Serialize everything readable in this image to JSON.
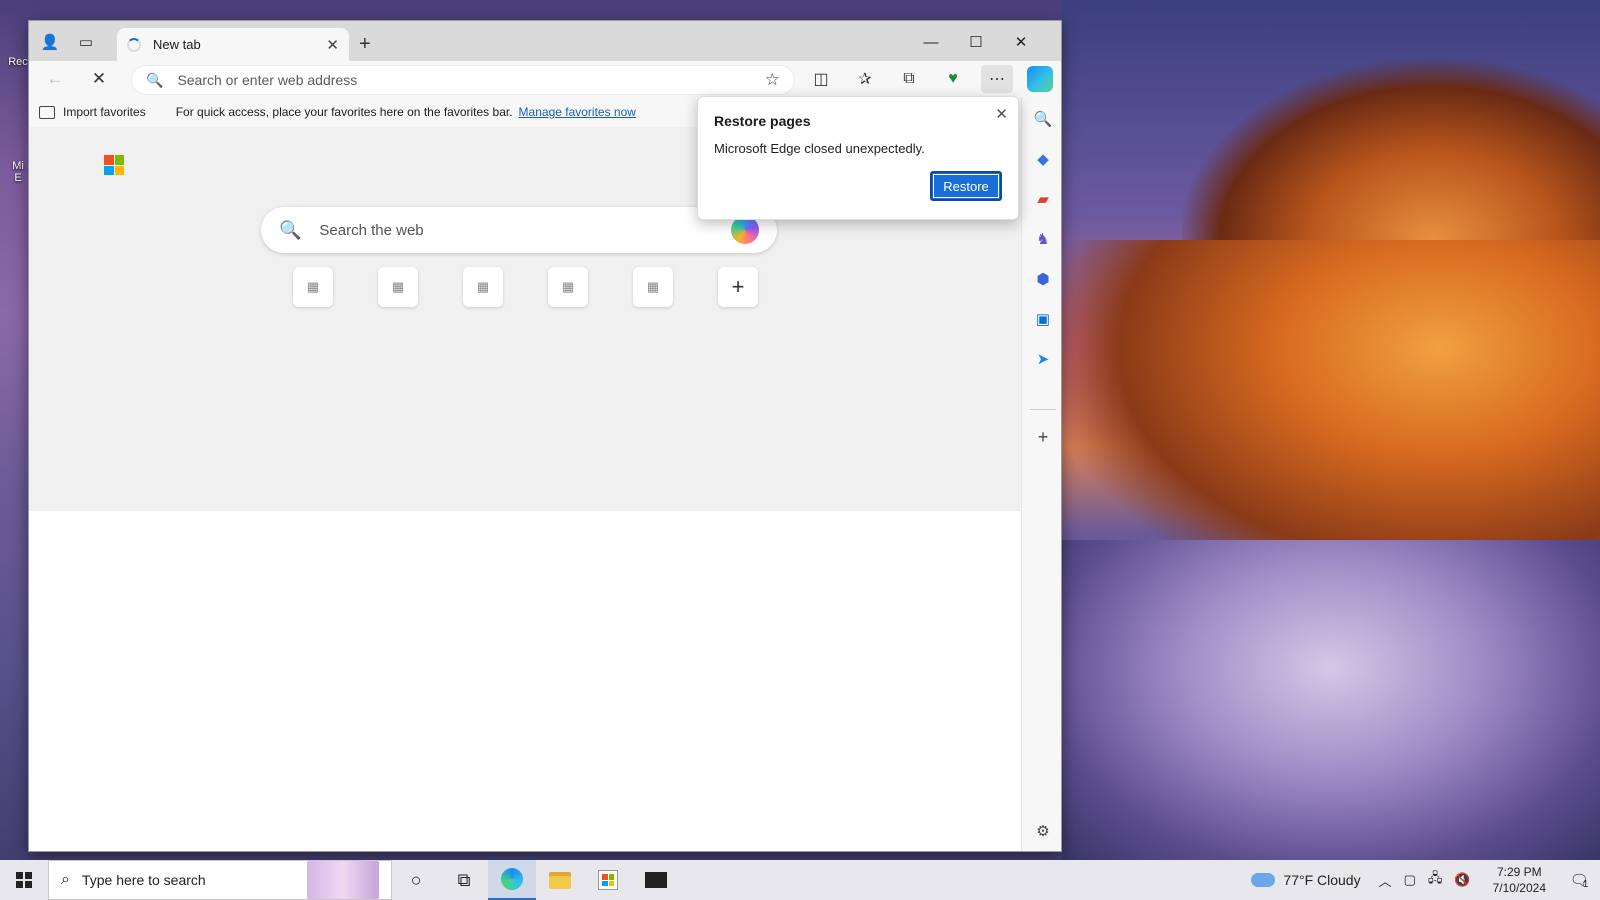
{
  "desktop": {
    "icons": [
      {
        "label": "Rec"
      },
      {
        "label": "Mi\nE"
      }
    ]
  },
  "browser": {
    "tab": {
      "title": "New tab"
    },
    "address": {
      "placeholder": "Search or enter web address"
    },
    "favorites_bar": {
      "import_label": "Import favorites",
      "hint": "For quick access, place your favorites here on the favorites bar.",
      "manage_link": "Manage favorites now"
    },
    "new_tab_page": {
      "search_placeholder": "Search the web",
      "tile_count": 5
    },
    "popup": {
      "title": "Restore pages",
      "message": "Microsoft Edge closed unexpectedly.",
      "button": "Restore"
    }
  },
  "taskbar": {
    "search_placeholder": "Type here to search",
    "weather": "77°F  Cloudy",
    "time": "7:29 PM",
    "date": "7/10/2024",
    "notification_count": "1"
  },
  "colors": {
    "accent": "#1a6ed8",
    "link": "#1a5fb4"
  }
}
